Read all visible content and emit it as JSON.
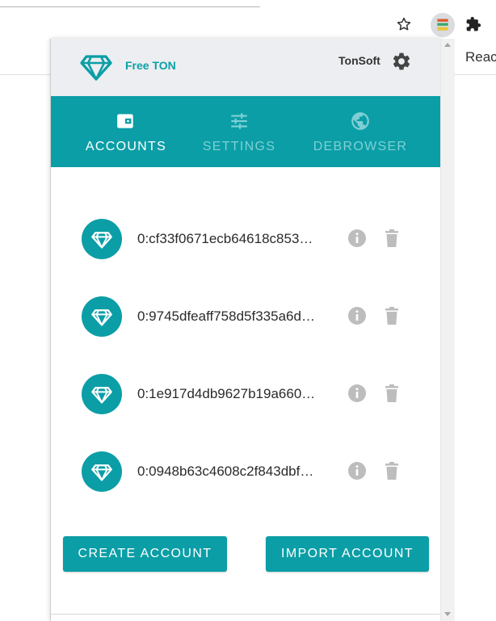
{
  "browser": {
    "reading_label": "Reac",
    "icons": [
      "star-icon",
      "extension-active-icon",
      "puzzle-icon"
    ]
  },
  "header": {
    "brand": "Free TON",
    "network": "TonSoft",
    "logo_icon": "diamond-icon",
    "settings_icon": "gear-icon"
  },
  "tabs": [
    {
      "label": "ACCOUNTS",
      "icon": "wallet-icon",
      "active": true
    },
    {
      "label": "SETTINGS",
      "icon": "sliders-icon",
      "active": false
    },
    {
      "label": "DEBROWSER",
      "icon": "globe-icon",
      "active": false
    }
  ],
  "accounts": [
    {
      "address": "0:cf33f0671ecb64618c853…"
    },
    {
      "address": "0:9745dfeaff758d5f335a6d…"
    },
    {
      "address": "0:1e917d4db9627b19a660…"
    },
    {
      "address": "0:0948b63c4608c2f843dbf…"
    }
  ],
  "actions": {
    "create_label": "CREATE ACCOUNT",
    "import_label": "IMPORT ACCOUNT"
  },
  "colors": {
    "accent": "#0b9ea6",
    "header_bg": "#eceef1",
    "inactive_tab_text": "#7fd0d4",
    "icon_gray": "#bdbdbd"
  }
}
